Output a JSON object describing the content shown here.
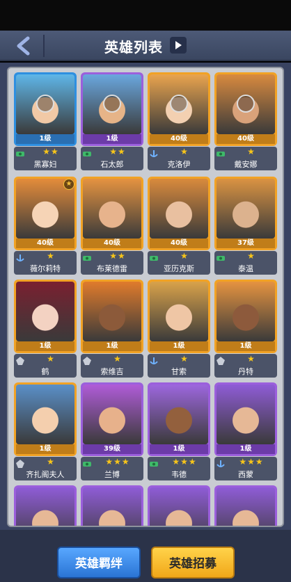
{
  "header": {
    "title": "英雄列表",
    "back_icon": "chevron-left-icon",
    "info_icon": "play-right-icon"
  },
  "cards": [
    {
      "name": "黑寡妇",
      "level": "1级",
      "stars": "★★",
      "rarity": "blue",
      "faction": "green-cash-icon",
      "locked": true
    },
    {
      "name": "石太郎",
      "level": "1级",
      "stars": "★★",
      "rarity": "purple",
      "faction": "green-cash-icon",
      "locked": true
    },
    {
      "name": "克洛伊",
      "level": "40级",
      "stars": "★",
      "rarity": "orange",
      "faction": "anchor-icon",
      "locked": true
    },
    {
      "name": "戴安娜",
      "level": "40级",
      "stars": "★",
      "rarity": "orange",
      "faction": "green-cash-icon",
      "locked": true
    },
    {
      "name": "薇尔莉特",
      "level": "40级",
      "stars": "★",
      "rarity": "orange",
      "faction": "anchor-icon",
      "locked": false,
      "badge": true
    },
    {
      "name": "布莱德雷",
      "level": "40级",
      "stars": "★★",
      "rarity": "orange",
      "faction": "green-cash-icon",
      "locked": false
    },
    {
      "name": "亚历克斯",
      "level": "40级",
      "stars": "★",
      "rarity": "orange",
      "faction": "green-cash-icon",
      "locked": false
    },
    {
      "name": "泰温",
      "level": "37级",
      "stars": "★",
      "rarity": "orange",
      "faction": "green-cash-icon",
      "locked": false
    },
    {
      "name": "鹤",
      "level": "1级",
      "stars": "★",
      "rarity": "orange",
      "faction": "emblem-icon",
      "locked": false
    },
    {
      "name": "索维吉",
      "level": "1级",
      "stars": "★",
      "rarity": "orange",
      "faction": "emblem-icon",
      "locked": false
    },
    {
      "name": "甘索",
      "level": "1级",
      "stars": "★",
      "rarity": "orange",
      "faction": "anchor-icon",
      "locked": false
    },
    {
      "name": "丹特",
      "level": "1级",
      "stars": "★",
      "rarity": "orange",
      "faction": "emblem-icon",
      "locked": false
    },
    {
      "name": "齐扎阁夫人",
      "level": "1级",
      "stars": "★",
      "rarity": "orange",
      "faction": "emblem-icon",
      "locked": false
    },
    {
      "name": "兰博",
      "level": "39级",
      "stars": "★★★",
      "rarity": "purple",
      "faction": "green-cash-icon",
      "locked": false
    },
    {
      "name": "韦德",
      "level": "1级",
      "stars": "★★★",
      "rarity": "purple",
      "faction": "green-cash-icon",
      "locked": false
    },
    {
      "name": "西蒙",
      "level": "1级",
      "stars": "★★★",
      "rarity": "purple",
      "faction": "anchor-icon",
      "locked": false
    },
    {
      "name": "",
      "level": "",
      "stars": "",
      "rarity": "purple",
      "faction": "",
      "locked": false
    },
    {
      "name": "",
      "level": "",
      "stars": "",
      "rarity": "purple",
      "faction": "",
      "locked": false
    },
    {
      "name": "",
      "level": "",
      "stars": "",
      "rarity": "purple",
      "faction": "",
      "locked": false
    },
    {
      "name": "",
      "level": "",
      "stars": "",
      "rarity": "purple",
      "faction": "",
      "locked": false
    }
  ],
  "buttons": {
    "bonds": "英雄羁绊",
    "recruit": "英雄招募"
  },
  "colors": {
    "blue": "#2e8fe0",
    "purple": "#9b5fdc",
    "orange": "#f1a225",
    "star": "#f7c51a"
  }
}
